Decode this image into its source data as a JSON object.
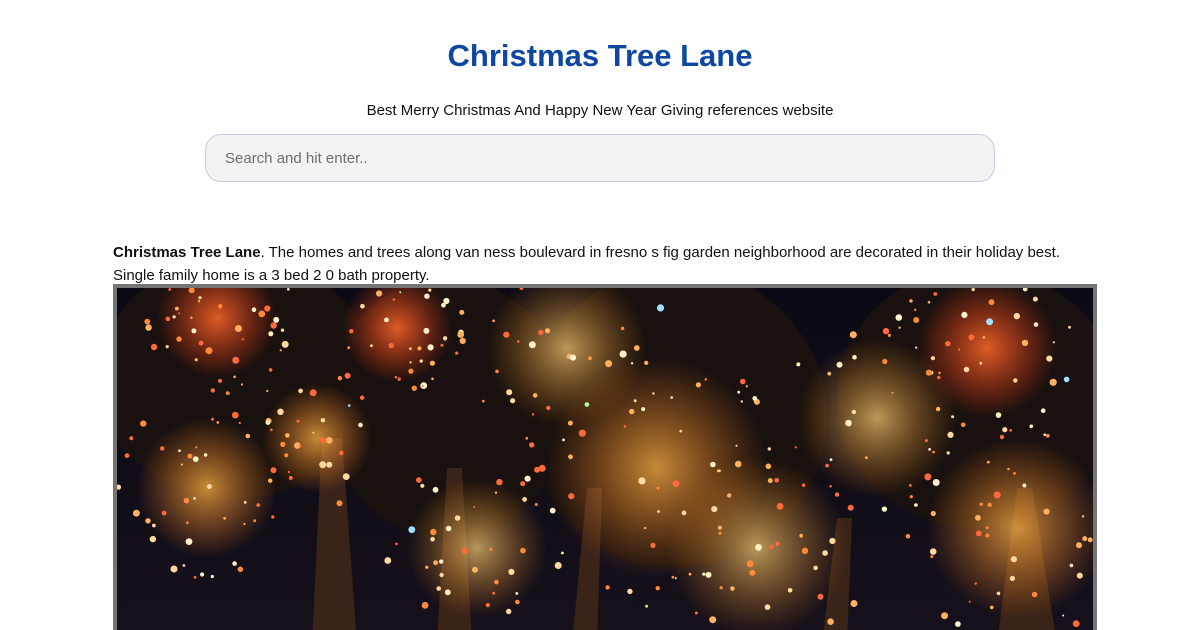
{
  "header": {
    "site_title": "Christmas Tree Lane",
    "tagline": "Best Merry Christmas And Happy New Year Giving references website"
  },
  "search": {
    "placeholder": "Search and hit enter.."
  },
  "article": {
    "intro_title": "Christmas Tree Lane",
    "intro_text": ". The homes and trees along van ness boulevard in fresno s fig garden neighborhood are decorated in their holiday best. Single family home is a 3 bed 2 0 bath property."
  },
  "colors": {
    "title_blue": "#0d47a1",
    "search_border": "#c5cbe6",
    "image_border": "#757575"
  }
}
